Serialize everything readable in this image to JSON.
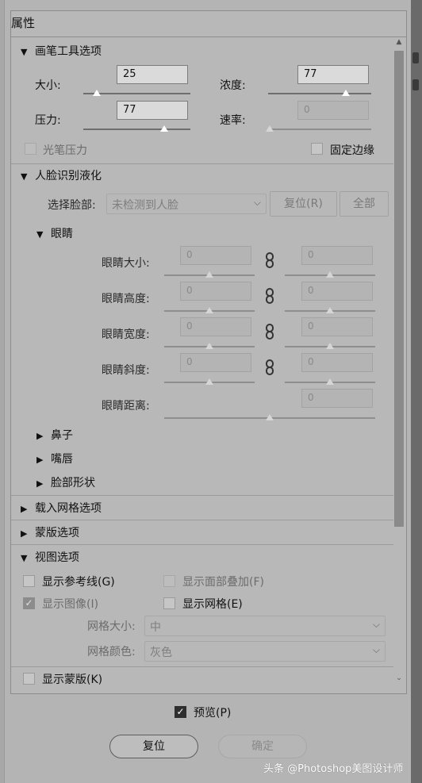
{
  "panel": {
    "title": "属性"
  },
  "brush": {
    "header": "画笔工具选项",
    "size_label": "大小:",
    "size_value": "25",
    "density_label": "浓度:",
    "density_value": "77",
    "pressure_label": "压力:",
    "pressure_value": "77",
    "rate_label": "速率:",
    "rate_value": "0",
    "pen_pressure_label": "光笔压力",
    "pin_edges_label": "固定边缘"
  },
  "face": {
    "header": "人脸识别液化",
    "select_face_label": "选择脸部:",
    "select_face_value": "未检测到人脸",
    "reset_label": "复位(R)",
    "all_label": "全部",
    "eyes_header": "眼睛",
    "eye_size_label": "眼睛大小:",
    "eye_size_left": "0",
    "eye_size_right": "0",
    "eye_height_label": "眼睛高度:",
    "eye_height_left": "0",
    "eye_height_right": "0",
    "eye_width_label": "眼睛宽度:",
    "eye_width_left": "0",
    "eye_width_right": "0",
    "eye_tilt_label": "眼睛斜度:",
    "eye_tilt_left": "0",
    "eye_tilt_right": "0",
    "eye_distance_label": "眼睛距离:",
    "eye_distance_value": "0",
    "nose_label": "鼻子",
    "mouth_label": "嘴唇",
    "face_shape_label": "脸部形状"
  },
  "load_mesh": {
    "header": "载入网格选项"
  },
  "mask_options": {
    "header": "蒙版选项"
  },
  "view": {
    "header": "视图选项",
    "show_guides_label": "显示参考线(G)",
    "show_face_overlay_label": "显示面部叠加(F)",
    "show_image_label": "显示图像(I)",
    "show_mesh_label": "显示网格(E)",
    "mesh_size_label": "网格大小:",
    "mesh_size_value": "中",
    "mesh_color_label": "网格颜色:",
    "mesh_color_value": "灰色",
    "show_mask_label": "显示蒙版(K)"
  },
  "footer": {
    "preview_label": "预览(P)",
    "reset_label": "复位",
    "ok_label": "确定"
  },
  "watermark": {
    "text": "头条 @Photoshop美图设计师"
  }
}
